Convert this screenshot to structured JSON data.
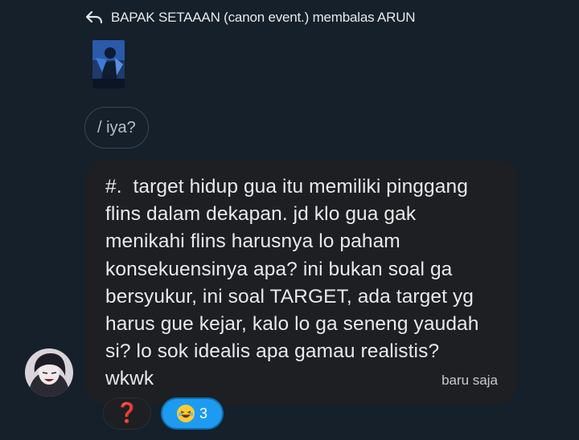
{
  "reply_header": {
    "text": "BAPAK SETAAAN (canon event.) membalas ARUN",
    "icon": "reply-arrow-icon"
  },
  "quoted_message": {
    "text": "/ iya?"
  },
  "message": {
    "text": "#.  target hidup gua itu memiliki pinggang\nflins dalam dekapan. jd klo gua gak\nmenikahi flins harusnya lo paham\nkonsekuensinya apa? ini bukan soal ga\nbersyukur, ini soal TARGET, ada target yg\nharus gue kejar, kalo lo ga seneng yaudah\nsi? lo sok idealis apa gamau realistis?\nwkwk",
    "time": "baru saja"
  },
  "reactions": [
    {
      "emoji": "❓",
      "count": ""
    },
    {
      "emoji": "😂",
      "count": "3"
    }
  ],
  "colors": {
    "background": "#15202b",
    "bubble": "#1e1f22",
    "accent": "#1d9bf0"
  }
}
